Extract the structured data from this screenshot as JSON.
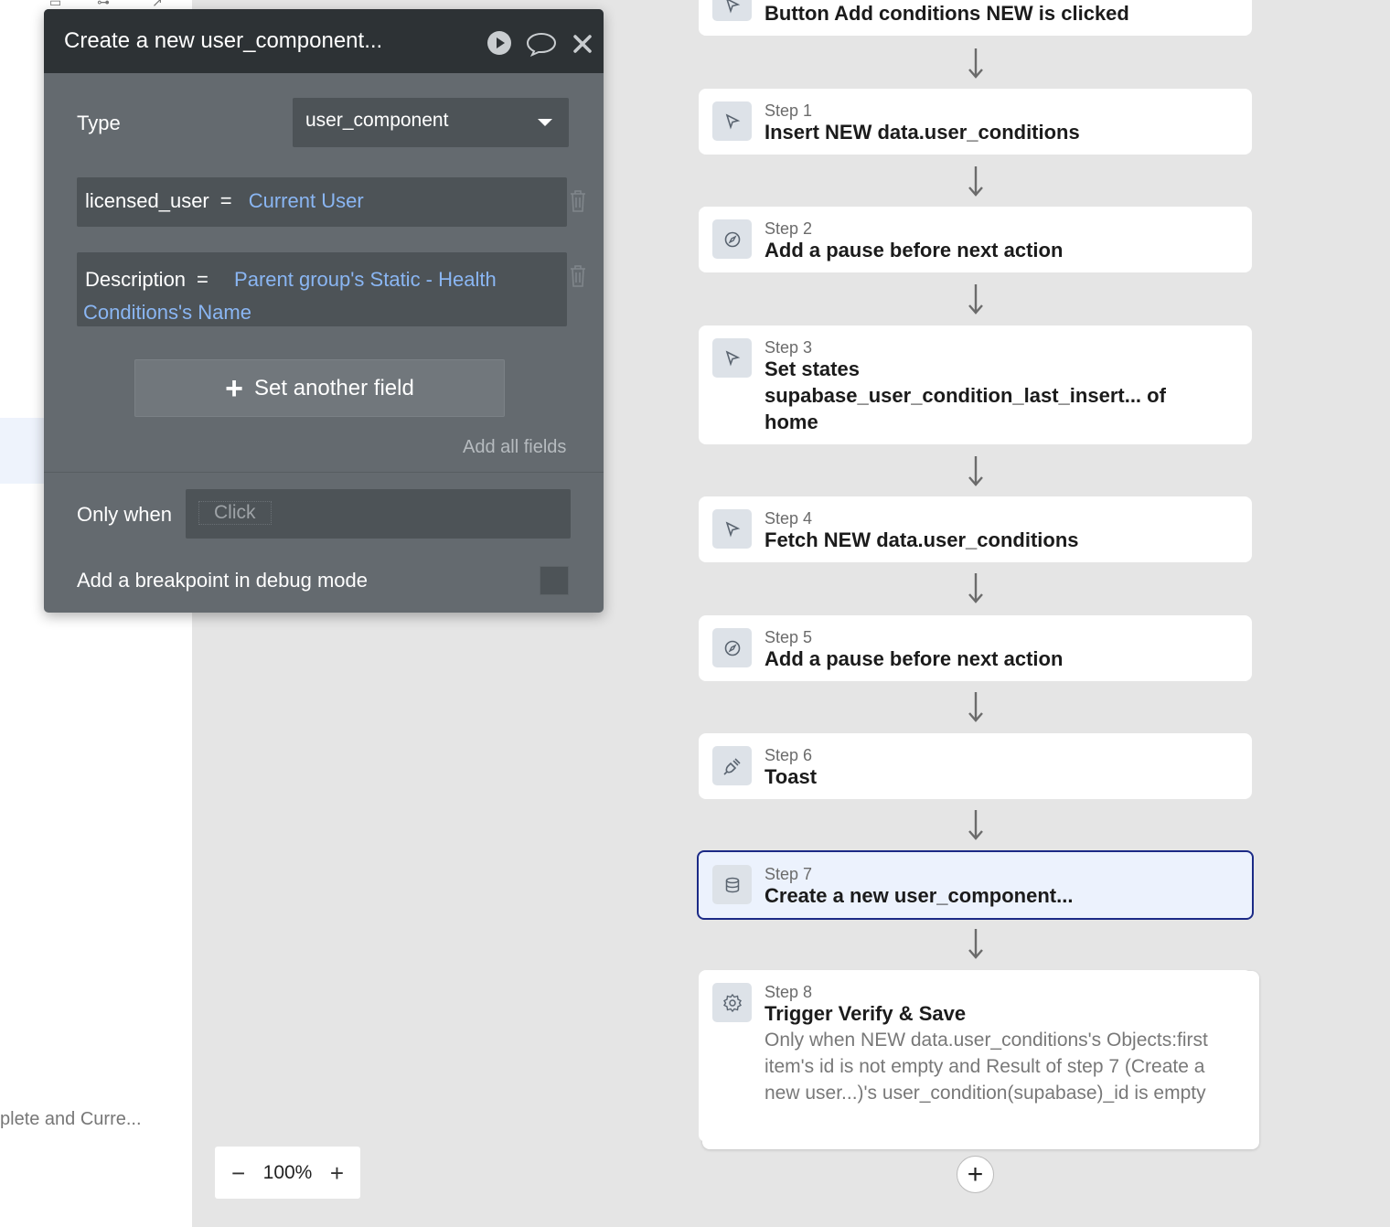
{
  "sidebar": {
    "bottom_text": "plete and Curre..."
  },
  "zoom": {
    "minus": "−",
    "level": "100%",
    "plus": "+"
  },
  "editor": {
    "title": "Create a new user_component...",
    "type_label": "Type",
    "type_value": "user_component",
    "fields": [
      {
        "name": "licensed_user",
        "eq": "=",
        "value": "Current User"
      },
      {
        "name": "Description",
        "eq": "=",
        "value": "Parent group's Static - Health Conditions's Name"
      }
    ],
    "set_another_label": "Set another field",
    "add_all_label": "Add all fields",
    "only_when_label": "Only when",
    "only_when_placeholder": "Click",
    "breakpoint_label": "Add a breakpoint in debug mode"
  },
  "workflow": {
    "trigger_title": "Button Add conditions NEW is clicked",
    "steps": [
      {
        "step": "Step 1",
        "title": "Insert NEW data.user_conditions",
        "icon": "cursor-icon"
      },
      {
        "step": "Step 2",
        "title": "Add a pause before next action",
        "icon": "compass-icon"
      },
      {
        "step": "Step 3",
        "title": "Set states supabase_user_condition_last_insert... of home",
        "icon": "cursor-icon"
      },
      {
        "step": "Step 4",
        "title": "Fetch NEW data.user_conditions",
        "icon": "cursor-icon"
      },
      {
        "step": "Step 5",
        "title": "Add a pause before next action",
        "icon": "compass-icon"
      },
      {
        "step": "Step 6",
        "title": "Toast",
        "icon": "plug-icon"
      },
      {
        "step": "Step 7",
        "title": "Create a new user_component...",
        "icon": "database-icon"
      },
      {
        "step": "Step 8",
        "title": "Trigger Verify & Save",
        "icon": "gear-icon",
        "condition": "Only when NEW data.user_conditions's Objects:first item's id is not empty and Result of step 7 (Create a new user...)'s user_condition(supabase)_id is empty"
      }
    ],
    "add_step_label": "+"
  },
  "colors": {
    "selected_border": "#1b2a86",
    "link_blue": "#8ab6f3",
    "panel_bg": "#646a6f",
    "panel_header": "#2d3235"
  }
}
